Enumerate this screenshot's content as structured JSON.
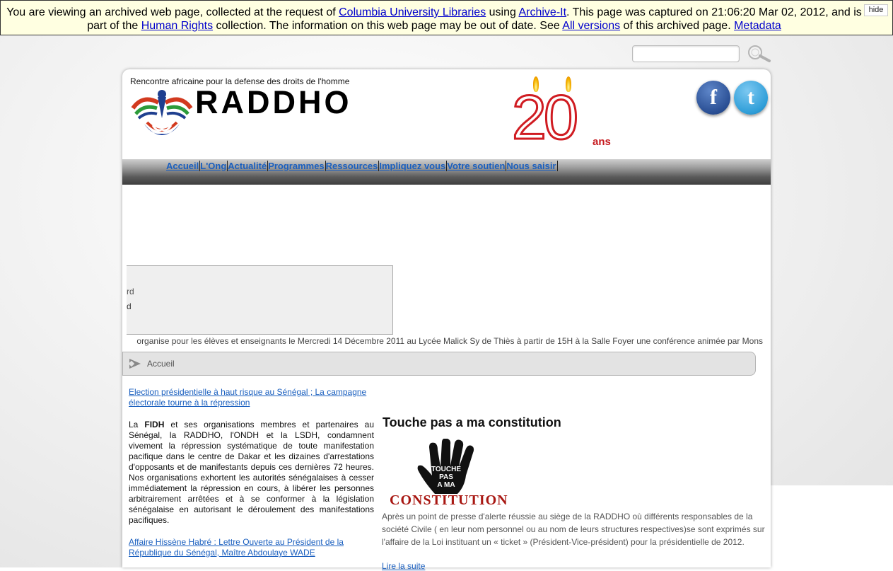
{
  "archive": {
    "t1": "You are viewing an archived web page, collected at the request of ",
    "l1": "Columbia University Libraries",
    "t2": " using ",
    "l2": "Archive-It",
    "t3": ". This page was captured on 21:06:20 Mar 02, 2012, and is part of the ",
    "l3": "Human Rights",
    "t4": " collection. The information on this web page may be out of date. See ",
    "l4": "All versions",
    "t5": " of this archived page. ",
    "l5": "Metadata",
    "hide": "hide"
  },
  "header": {
    "tagline": "Rencontre africaine pour la defense des droits de l'homme",
    "brand": "RADDHO",
    "anniversary_number": "20",
    "anniversary_suffix": "ans",
    "facebook_glyph": "f",
    "twitter_glyph": "t"
  },
  "nav": [
    "Accueil",
    "L'Ong",
    "Actualité",
    "Programmes",
    "Ressources",
    "Impliquez vous",
    "Votre soutien",
    "Nous saisir"
  ],
  "slider": {
    "line1": "rd",
    "line2": "d"
  },
  "ticker": "organise pour les élèves et enseignants le Mercredi 14 Décembre 2011 au Lycée Malick Sy de Thiès à partir de 15H à la Salle Foyer une conférence animée par Mons",
  "breadcrumb": "Accueil",
  "left": {
    "article1_link": "Election présidentielle à haut risque au Sénégal ; La campagne électorale tourne à la répression",
    "article1_lead": " La ",
    "article1_strong": "FIDH",
    "article1_body": " et ses organisations membres et partenaires au Sénégal, la RADDHO, l'ONDH et la LSDH, condamnent vivement la répression systématique de toute manifestation pacifique dans le centre de Dakar et les dizaines d'arrestations d'opposants et de manifestants depuis ces dernières 72 heures. Nos organisations exhortent les autorités sénégalaises à cesser immédiatement la répression en cours, à libérer les personnes arbitrairement arrêtées et à se conformer à la législation sénégalaise en autorisant le déroulement des manifestations pacifiques.",
    "article2_link": "Affaire Hissène Habré : Lettre Ouverte au Président de la République du Sénégal, Maître Abdoulaye WADE"
  },
  "right": {
    "title": "Touche pas a ma constitution",
    "hand_text": "TOUCHE PAS A MA",
    "banner": "CONSTITUTION",
    "body": "Après un point de presse d'alerte réussie au siège de la RADDHO où différents responsables de la société Civile ( en leur nom personnel ou au nom de leurs structures respectives)se sont exprimés sur l'affaire de la Loi instituant un « ticket » (Président-Vice-président) pour la présidentielle de 2012.",
    "read_more": "Lire la suite"
  }
}
